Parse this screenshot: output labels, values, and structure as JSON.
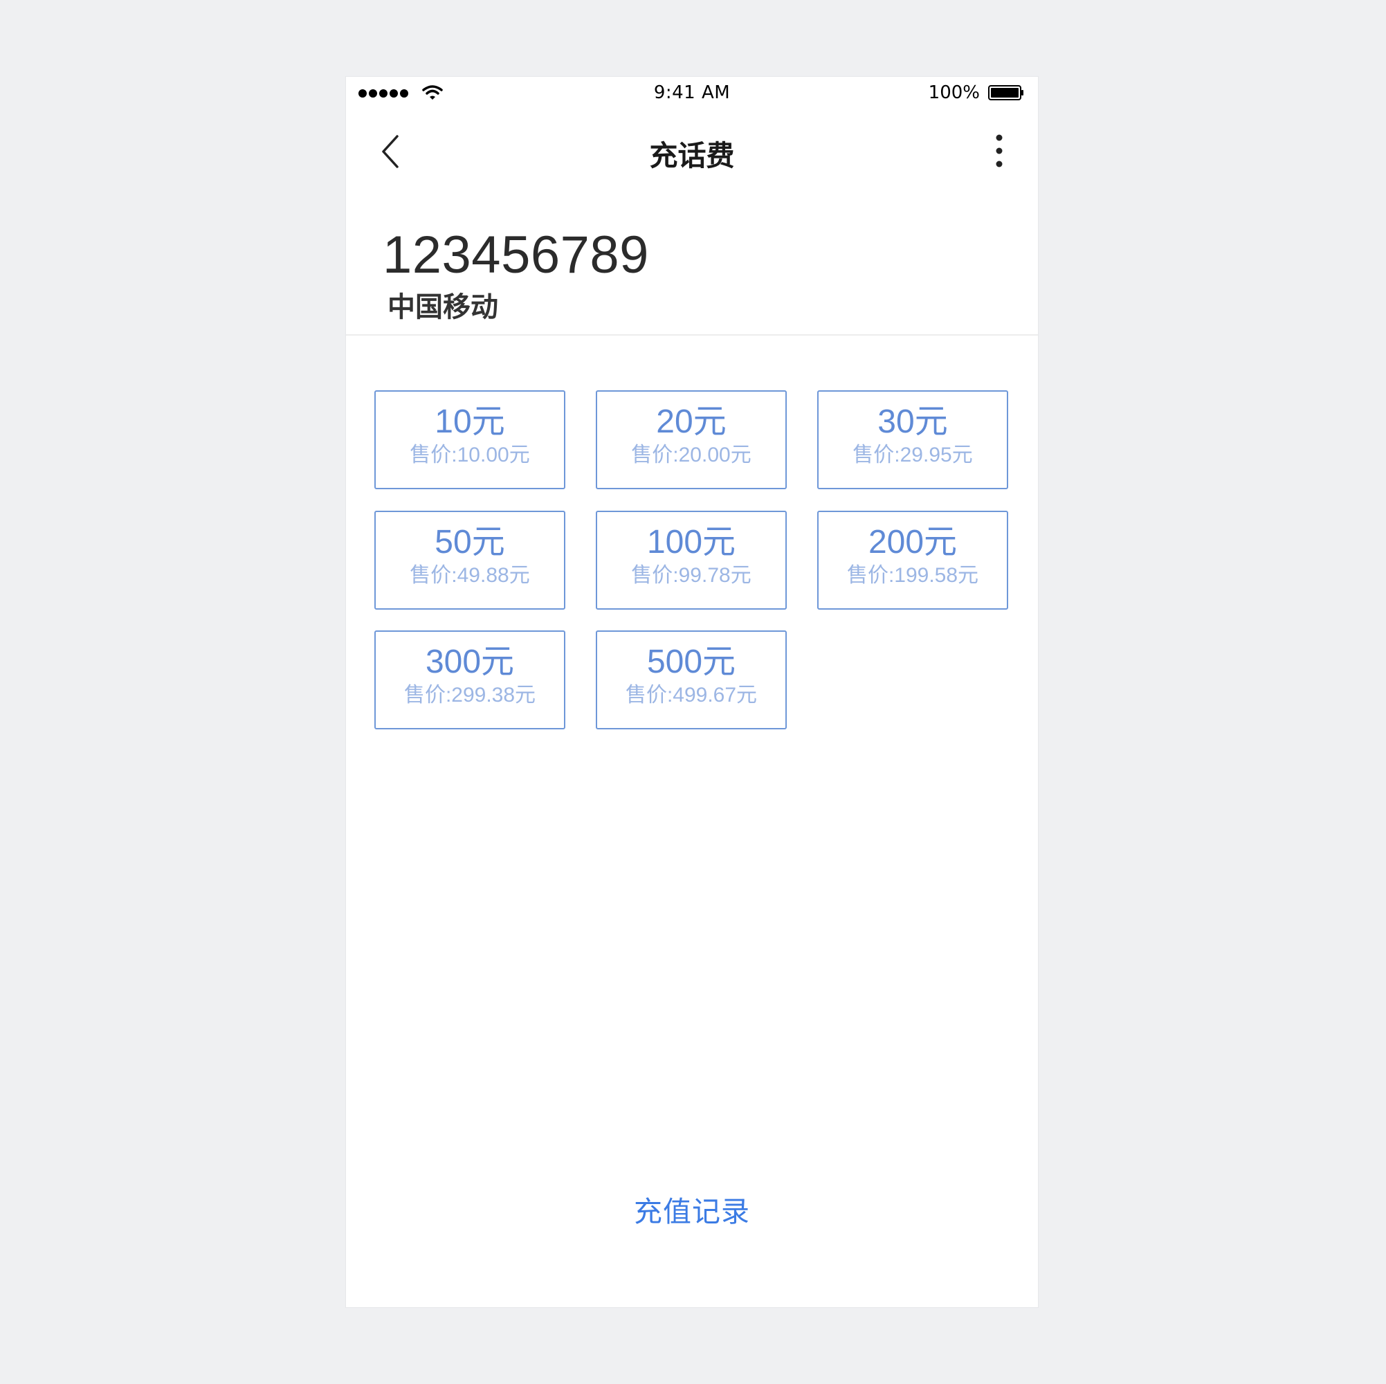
{
  "status_bar": {
    "time": "9:41 AM",
    "battery_percent": "100%"
  },
  "nav": {
    "title": "充话费"
  },
  "account": {
    "phone_number": "123456789",
    "carrier": "中国移动"
  },
  "plans": [
    {
      "face": "10元",
      "price": "售价:10.00元"
    },
    {
      "face": "20元",
      "price": "售价:20.00元"
    },
    {
      "face": "30元",
      "price": "售价:29.95元"
    },
    {
      "face": "50元",
      "price": "售价:49.88元"
    },
    {
      "face": "100元",
      "price": "售价:99.78元"
    },
    {
      "face": "200元",
      "price": "售价:199.58元"
    },
    {
      "face": "300元",
      "price": "售价:299.38元"
    },
    {
      "face": "500元",
      "price": "售价:499.67元"
    }
  ],
  "footer": {
    "history_label": "充值记录"
  },
  "colors": {
    "accent": "#5f8ad6",
    "link": "#3b7be4",
    "background": "#eff0f2"
  },
  "icons": {
    "back": "chevron-left-icon",
    "more": "more-vertical-icon",
    "wifi": "wifi-icon",
    "battery": "battery-icon",
    "signal": "signal-icon"
  }
}
